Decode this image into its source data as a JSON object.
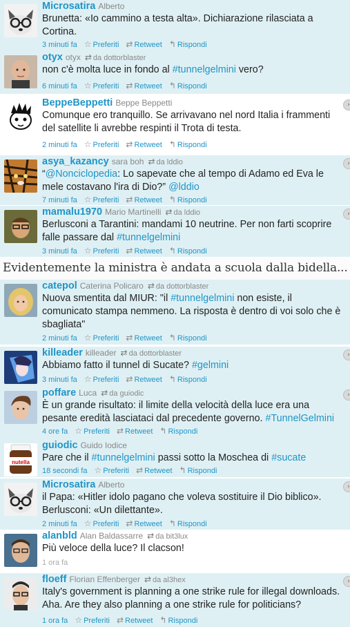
{
  "banner": "Evidentemente la ministra è andata a scuola dalla bidella...",
  "actions": {
    "fav": "Preferiti",
    "rt": "Retweet",
    "reply": "Rispondi",
    "retweet_prefix": "da"
  },
  "tweets": [
    {
      "screen": "Microsatira",
      "name": "Alberto",
      "via": "",
      "time": "3 minuti fa",
      "parts": [
        {
          "t": "Brunetta: «Io cammino a testa alta». Dichiarazione rilasciata a Cortina."
        }
      ]
    },
    {
      "screen": "otyx",
      "name": "otyx",
      "via": "dottorblaster",
      "time": "6 minuti fa",
      "parts": [
        {
          "t": "non c'è molta luce in fondo al "
        },
        {
          "t": "#tunnelgelmini",
          "l": true
        },
        {
          "t": " vero?"
        }
      ]
    },
    {
      "screen": "BeppeBeppetti",
      "name": "Beppe Beppetti",
      "via": "",
      "time": "2 minuti fa",
      "parts": [
        {
          "t": "Comunque ero tranquillo. Se arrivavano nel nord Italia i frammenti del satellite li avrebbe respinti il Trota di testa."
        }
      ]
    },
    {
      "screen": "asya_kazancy",
      "name": "sara boh",
      "via": "lddio",
      "time": "7 minuti fa",
      "parts": [
        {
          "t": "“"
        },
        {
          "t": "@Nonciclopedia",
          "l": true
        },
        {
          "t": ": Lo sapevate che al tempo di Adamo ed Eva le mele costavano l'ira di Dio?” "
        },
        {
          "t": "@lddio",
          "l": true
        }
      ]
    },
    {
      "screen": "mamalu1970",
      "name": "Mario Martinelli",
      "via": "lddio",
      "time": "3 minuti fa",
      "parts": [
        {
          "t": "Berlusconi a Tarantini: mandami 10 neutrine. Per non farti scoprire falle passare dal "
        },
        {
          "t": "#tunnelgelmini",
          "l": true
        }
      ]
    },
    {
      "screen": "catepol",
      "name": "Caterina Policaro",
      "via": "dottorblaster",
      "time": "2 minuti fa",
      "parts": [
        {
          "t": "Nuova smentita dal MIUR: \"il "
        },
        {
          "t": "#tunnelgelmini",
          "l": true
        },
        {
          "t": " non esiste, il comunicato stampa nemmeno. La risposta è dentro di voi solo che è sbagliata\""
        }
      ]
    },
    {
      "screen": "killeader",
      "name": "killeader",
      "via": "dottorblaster",
      "time": "3 minuti fa",
      "parts": [
        {
          "t": "Abbiamo fatto il tunnel di Sucate? "
        },
        {
          "t": "#gelmini",
          "l": true
        }
      ]
    },
    {
      "screen": "poffare",
      "name": "Luca",
      "via": "guiodic",
      "time": "4 ore fa",
      "parts": [
        {
          "t": "È un grande risultato: il limite della velocità della luce era una pesante eredità lasciataci dal precedente governo. "
        },
        {
          "t": "#TunnelGelmini",
          "l": true
        }
      ]
    },
    {
      "screen": "guiodic",
      "name": "Guido Iodice",
      "via": "",
      "time": "18 secondi fa",
      "parts": [
        {
          "t": "Pare che il "
        },
        {
          "t": "#tunnelgelmini",
          "l": true
        },
        {
          "t": " passi sotto la Moschea di "
        },
        {
          "t": "#sucate",
          "l": true
        }
      ]
    },
    {
      "screen": "Microsatira",
      "name": "Alberto",
      "via": "",
      "time": "2 minuti fa",
      "parts": [
        {
          "t": "il Papa: «Hitler idolo pagano che voleva sostituire il Dio biblico». Berlusconi: «Un dilettante»."
        }
      ]
    },
    {
      "screen": "alanbld",
      "name": "Alan Baldassarre",
      "via": "bit3lux",
      "time": "1 ora fa",
      "parts": [
        {
          "t": "Più veloce della luce? Il clacson!"
        }
      ]
    },
    {
      "screen": "floeff",
      "name": "Florian Effenberger",
      "via": "al3hex",
      "time": "1 ora fa",
      "parts": [
        {
          "t": "Italy's government is planning a one strike rule for illegal downloads. Aha. Are they also planning a one strike rule for politicians?"
        }
      ]
    }
  ]
}
